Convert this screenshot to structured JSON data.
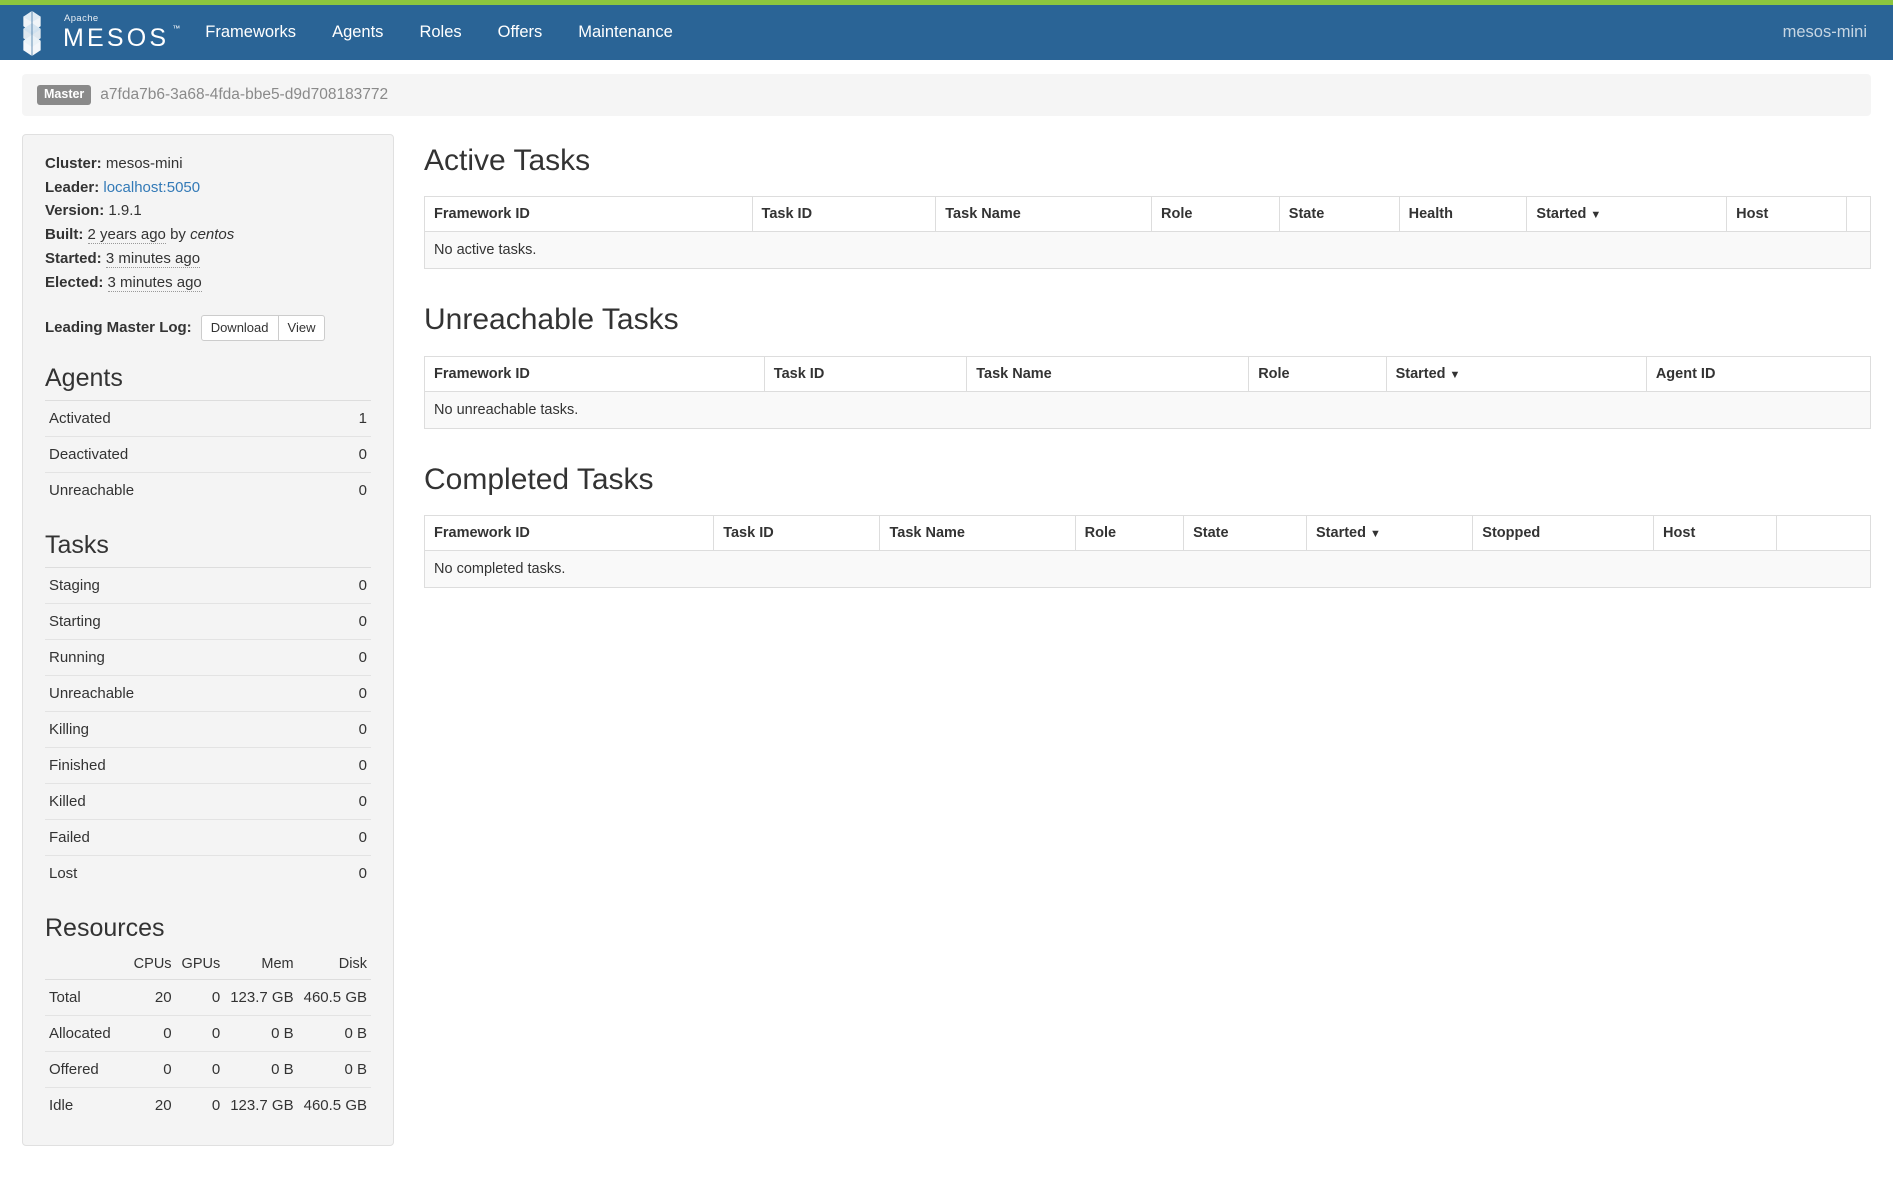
{
  "navbar": {
    "brand_apache": "Apache",
    "brand_name": "MESOS",
    "brand_tm": "™",
    "links": [
      {
        "label": "Frameworks"
      },
      {
        "label": "Agents"
      },
      {
        "label": "Roles"
      },
      {
        "label": "Offers"
      },
      {
        "label": "Maintenance"
      }
    ],
    "cluster_name": "mesos-mini",
    "accent_color": "#8cc63e",
    "background_color": "#2a6496"
  },
  "breadcrumb": {
    "badge": "Master",
    "master_id": "a7fda7b6-3a68-4fda-bbe5-d9d708183772"
  },
  "sidebar": {
    "meta": {
      "cluster_label": "Cluster:",
      "cluster_value": "mesos-mini",
      "leader_label": "Leader:",
      "leader_value": "localhost:5050",
      "version_label": "Version:",
      "version_value": "1.9.1",
      "built_label": "Built:",
      "built_value": "2 years ago",
      "built_by": "by",
      "built_user": "centos",
      "started_label": "Started:",
      "started_value": "3 minutes ago",
      "elected_label": "Elected:",
      "elected_value": "3 minutes ago"
    },
    "log": {
      "label": "Leading Master Log:",
      "download_label": "Download",
      "view_label": "View"
    },
    "agents": {
      "title": "Agents",
      "rows": [
        {
          "label": "Activated",
          "value": "1"
        },
        {
          "label": "Deactivated",
          "value": "0"
        },
        {
          "label": "Unreachable",
          "value": "0"
        }
      ]
    },
    "tasks": {
      "title": "Tasks",
      "rows": [
        {
          "label": "Staging",
          "value": "0"
        },
        {
          "label": "Starting",
          "value": "0"
        },
        {
          "label": "Running",
          "value": "0"
        },
        {
          "label": "Unreachable",
          "value": "0"
        },
        {
          "label": "Killing",
          "value": "0"
        },
        {
          "label": "Finished",
          "value": "0"
        },
        {
          "label": "Killed",
          "value": "0"
        },
        {
          "label": "Failed",
          "value": "0"
        },
        {
          "label": "Lost",
          "value": "0"
        }
      ]
    },
    "resources": {
      "title": "Resources",
      "columns": [
        "",
        "CPUs",
        "GPUs",
        "Mem",
        "Disk"
      ],
      "rows": [
        {
          "label": "Total",
          "cpus": "20",
          "gpus": "0",
          "mem": "123.7 GB",
          "disk": "460.5 GB"
        },
        {
          "label": "Allocated",
          "cpus": "0",
          "gpus": "0",
          "mem": "0 B",
          "disk": "0 B"
        },
        {
          "label": "Offered",
          "cpus": "0",
          "gpus": "0",
          "mem": "0 B",
          "disk": "0 B"
        },
        {
          "label": "Idle",
          "cpus": "20",
          "gpus": "0",
          "mem": "123.7 GB",
          "disk": "460.5 GB"
        }
      ]
    }
  },
  "main": {
    "active_tasks": {
      "title": "Active Tasks",
      "columns": [
        "Framework ID",
        "Task ID",
        "Task Name",
        "Role",
        "State",
        "Health",
        "Started",
        "Host",
        ""
      ],
      "sorted_column": "Started",
      "sort_caret": "▼",
      "empty_message": "No active tasks."
    },
    "unreachable_tasks": {
      "title": "Unreachable Tasks",
      "columns": [
        "Framework ID",
        "Task ID",
        "Task Name",
        "Role",
        "Started",
        "Agent ID"
      ],
      "sorted_column": "Started",
      "sort_caret": "▼",
      "empty_message": "No unreachable tasks."
    },
    "completed_tasks": {
      "title": "Completed Tasks",
      "columns": [
        "Framework ID",
        "Task ID",
        "Task Name",
        "Role",
        "State",
        "Started",
        "Stopped",
        "Host",
        ""
      ],
      "sorted_column": "Started",
      "sort_caret": "▼",
      "empty_message": "No completed tasks."
    }
  }
}
